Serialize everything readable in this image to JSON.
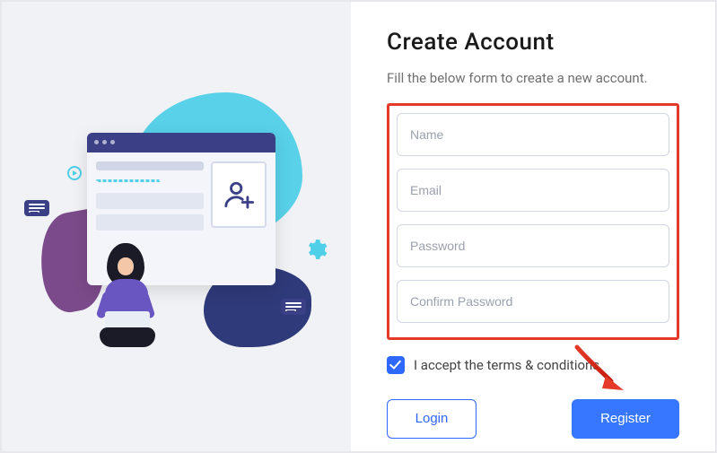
{
  "form": {
    "title": "Create Account",
    "subtitle": "Fill the below form to create a new account.",
    "fields": {
      "name_placeholder": "Name",
      "email_placeholder": "Email",
      "password_placeholder": "Password",
      "confirm_placeholder": "Confirm Password"
    },
    "terms_label": "I accept the terms & conditions",
    "terms_checked": true,
    "login_label": "Login",
    "register_label": "Register"
  },
  "annotation": {
    "highlight_box_color": "#e53a2a",
    "arrow_color": "#e53a2a",
    "arrow_points_to": "register-button"
  },
  "illustration": {
    "description": "signup-illustration",
    "icons": [
      "add-user-icon",
      "gear-icon",
      "chat-icon",
      "play-icon"
    ]
  }
}
